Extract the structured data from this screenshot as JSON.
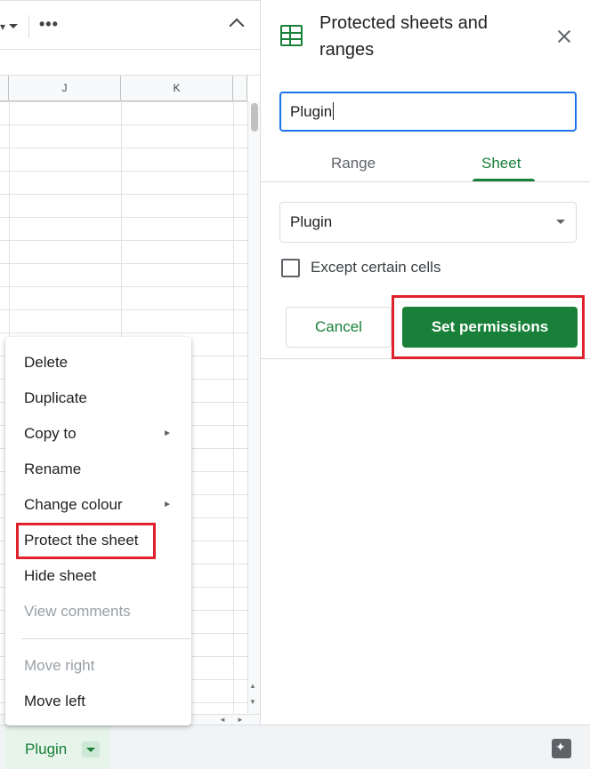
{
  "toolbar": {
    "more_icon": "more-horiz-icon",
    "more_glyph": "•••"
  },
  "grid": {
    "columns": [
      "J",
      "K"
    ]
  },
  "context_menu": {
    "items": [
      {
        "label": "Delete",
        "enabled": true
      },
      {
        "label": "Duplicate",
        "enabled": true
      },
      {
        "label": "Copy to",
        "enabled": true,
        "submenu": true
      },
      {
        "label": "Rename",
        "enabled": true
      },
      {
        "label": "Change colour",
        "enabled": true,
        "submenu": true
      },
      {
        "label": "Protect the sheet",
        "enabled": true,
        "highlighted": true
      },
      {
        "label": "Hide sheet",
        "enabled": true
      },
      {
        "label": "View comments",
        "enabled": false
      },
      {
        "label": "Move right",
        "enabled": false
      },
      {
        "label": "Move left",
        "enabled": true
      }
    ],
    "submenu_glyph": "►"
  },
  "panel": {
    "title": "Protected sheets and ranges",
    "description_value": "Plugin",
    "tabs": [
      {
        "label": "Range",
        "active": false
      },
      {
        "label": "Sheet",
        "active": true
      }
    ],
    "sheet_select_value": "Plugin",
    "except_cells_label": "Except certain cells",
    "except_cells_checked": false,
    "cancel_label": "Cancel",
    "set_permissions_label": "Set permissions"
  },
  "sheetbar": {
    "active_sheet": "Plugin"
  },
  "colors": {
    "accent_green": "#188038",
    "focus_blue": "#1a73e8",
    "highlight_red": "#e0202b"
  }
}
